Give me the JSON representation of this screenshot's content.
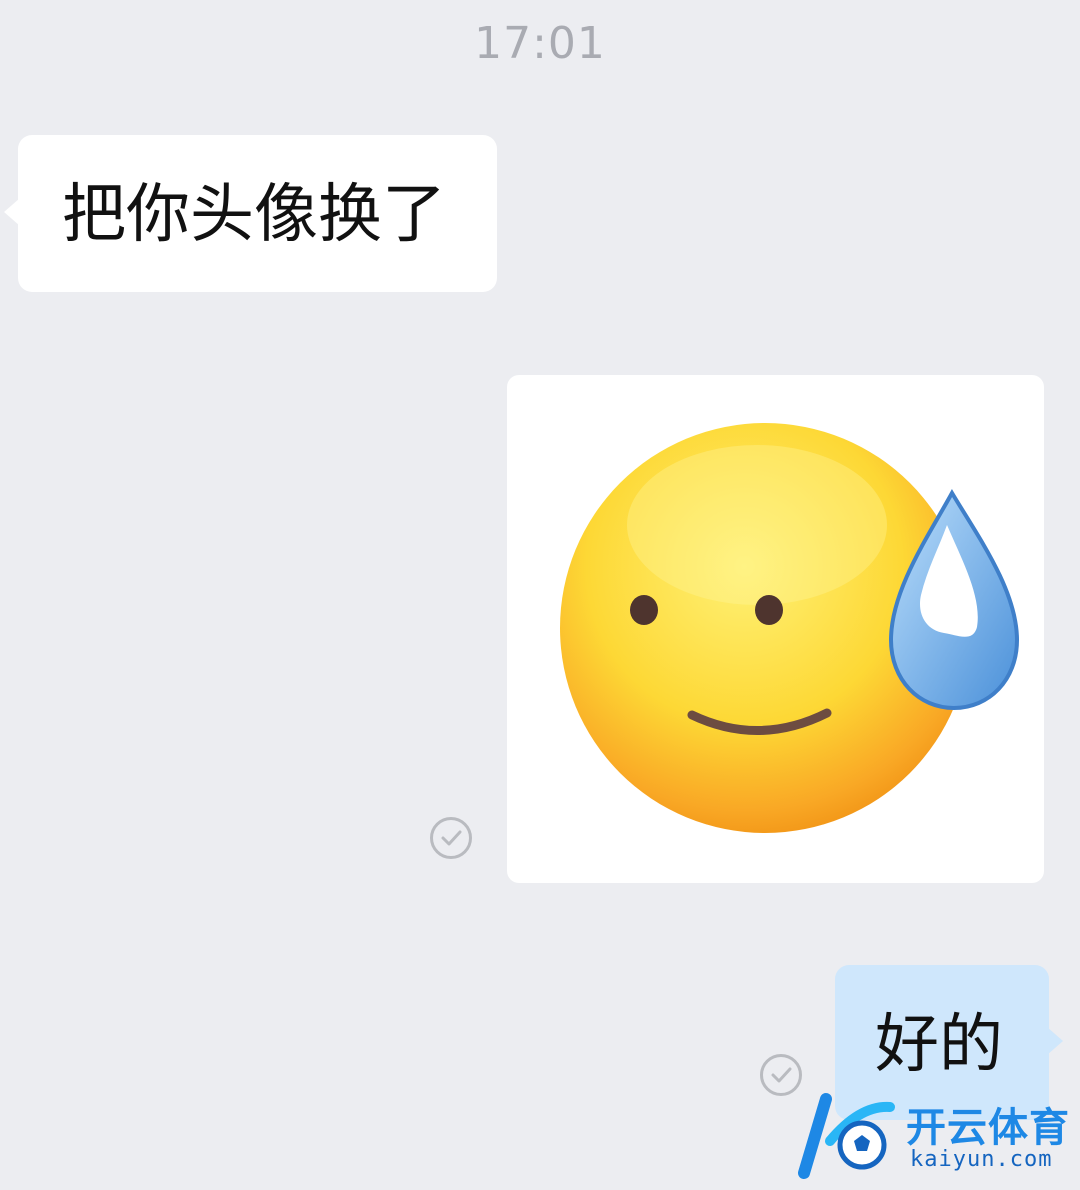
{
  "chat": {
    "timestamp": "17:01",
    "messages": [
      {
        "direction": "incoming",
        "type": "text",
        "text": "把你头像换了"
      },
      {
        "direction": "outgoing",
        "type": "image",
        "image_icon": "sweat-smile-emoji-icon",
        "status": "read-check-icon"
      },
      {
        "direction": "outgoing",
        "type": "text",
        "text": "好的",
        "status": "read-check-icon"
      }
    ]
  },
  "watermark": {
    "name_cn": "开云体育",
    "domain": "kaiyun.com",
    "logo_icon": "kaiyun-k-logo-icon"
  },
  "colors": {
    "background": "#ECEDF1",
    "incoming_bubble": "#FFFFFF",
    "outgoing_bubble": "#CFE7FC",
    "timestamp": "#A9ABB2",
    "watermark_blue": "#1E88E5"
  }
}
